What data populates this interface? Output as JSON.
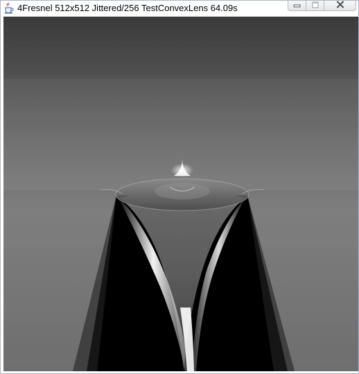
{
  "window": {
    "title": "4Fresnel 512x512 Jittered/256  TestConvexLens 64.09s",
    "app_icon": "java-cup-icon",
    "controls": {
      "minimize_icon": "minimize-icon",
      "maximize_icon": "maximize-icon",
      "close_icon": "close-icon"
    }
  },
  "render": {
    "description_icon": "rendered-image",
    "colors": {
      "background_top": "#3a3a3a",
      "background_mid": "#7a7a7a",
      "shadow": "#050505",
      "caustic": "#ffffff"
    }
  }
}
